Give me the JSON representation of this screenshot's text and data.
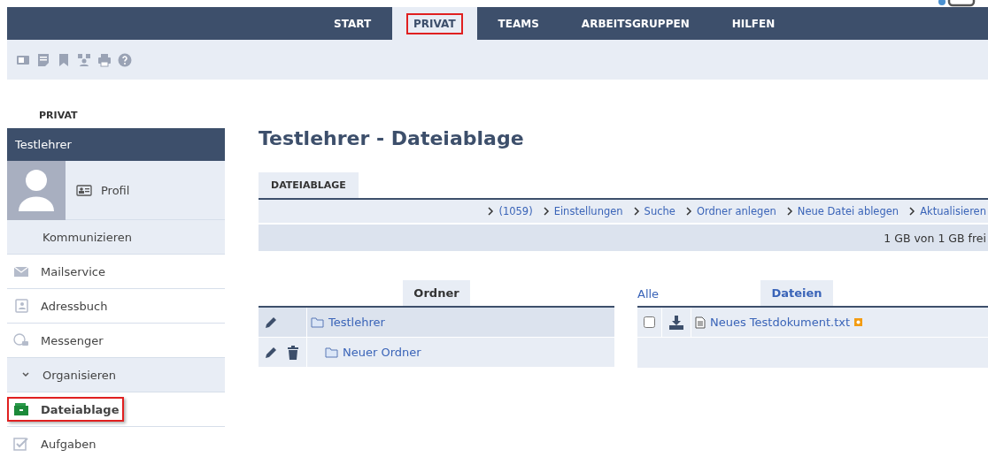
{
  "nav": [
    {
      "label": "START",
      "selected": false,
      "highlighted": false
    },
    {
      "label": "PRIVAT",
      "selected": true,
      "highlighted": true
    },
    {
      "label": "TEAMS",
      "selected": false,
      "highlighted": false
    },
    {
      "label": "ARBEITSGRUPPEN",
      "selected": false,
      "highlighted": false
    },
    {
      "label": "HILFEN",
      "selected": false,
      "highlighted": false
    }
  ],
  "toolbar": [
    {
      "kind": "window"
    },
    {
      "kind": "note"
    },
    {
      "kind": "bookmark"
    },
    {
      "kind": "network"
    },
    {
      "kind": "print"
    },
    {
      "kind": "help"
    }
  ],
  "sidebar": {
    "section": "PRIVAT",
    "user": "Testlehrer",
    "profile": "Profil",
    "items": [
      {
        "label": "Kommunizieren",
        "kind": "group",
        "selected": false,
        "highlighted": false
      },
      {
        "label": "Mailservice",
        "kind": "mail",
        "selected": false,
        "highlighted": false
      },
      {
        "label": "Adressbuch",
        "kind": "contacts",
        "selected": false,
        "highlighted": false
      },
      {
        "label": "Messenger",
        "kind": "chat",
        "selected": false,
        "highlighted": false
      },
      {
        "label": "Organisieren",
        "kind": "expandable",
        "selected": false,
        "highlighted": false
      },
      {
        "label": "Dateiablage",
        "kind": "files",
        "selected": true,
        "highlighted": true
      },
      {
        "label": "Aufgaben",
        "kind": "tasks",
        "selected": false,
        "highlighted": false
      }
    ]
  },
  "page_title": "Testlehrer - Dateiablage",
  "tab": "DATEIABLAGE",
  "actions": [
    "(1059)",
    "Einstellungen",
    "Suche",
    "Ordner anlegen",
    "Neue Datei ablegen",
    "Aktualisieren"
  ],
  "quota": "1 GB von 1 GB frei",
  "folders": {
    "heading": "Ordner",
    "rows": [
      {
        "name": "Testlehrer",
        "deletable": false,
        "children": [
          {
            "name": "Neuer Ordner",
            "deletable": true
          }
        ]
      }
    ]
  },
  "files": {
    "all_link": "Alle",
    "heading": "Dateien",
    "rows": [
      {
        "name": "Neues Testdokument.txt",
        "checked": false,
        "new": true
      }
    ]
  }
}
